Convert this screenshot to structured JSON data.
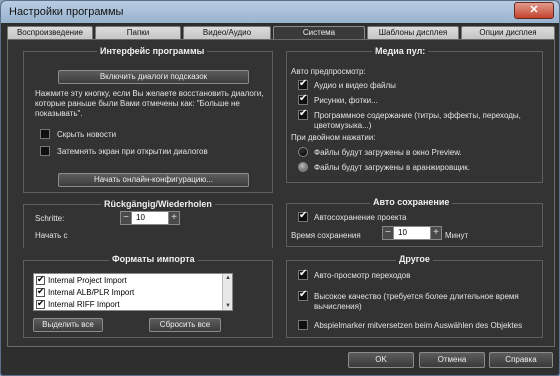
{
  "window": {
    "title": "Настройки программы",
    "close": "✕"
  },
  "tabs": [
    "Воспроизведение",
    "Папки",
    "Видео/Аудио",
    "Система",
    "Шаблоны дисплея",
    "Опции дисплея"
  ],
  "interface": {
    "title": "Интерфейс программы",
    "restore_button": "Включить диалоги подсказок",
    "description": "Нажмите эту кнопку, если Вы желаете восстановить диалоги, которые раньше были Вами отмечены как: \"Больше не показывать\".",
    "hide_news": "Скрыть новости",
    "dim_screen": "Затемнять экран при открытии диалогов",
    "online_config_button": "Начать онлайн-конфигурацию..."
  },
  "undo": {
    "title": "Rückgängig/Wiederholen",
    "steps_label": "Schritte:",
    "steps_value": "10",
    "start_label": "Начать с"
  },
  "import_formats": {
    "title": "Форматы импорта",
    "items": [
      "Internal Project Import",
      "Internal ALB/PLR Import",
      "Internal RIFF Import"
    ],
    "select_all": "Выделить все",
    "reset_all": "Сбросить все"
  },
  "media_pool": {
    "title": "Медиа пул:",
    "auto_preview_label": "Авто предпросмотр:",
    "audio_video": "Аудио и видео файлы",
    "images": "Рисунки, фотки...",
    "program_content": "Программное содержание (титры, эффекты, переходы, цветомузыка...)",
    "double_click_label": "При двойном нажатии:",
    "load_preview": "Файлы будут загружены в окно Preview.",
    "load_arranger": "Файлы будут загружены в аранжировщик."
  },
  "autosave": {
    "title": "Авто сохранение",
    "autosave_project": "Автосохранение проекта",
    "save_time_label": "Время сохранения",
    "save_time_value": "10",
    "minutes": "Минут"
  },
  "other": {
    "title": "Другое",
    "auto_preview_transitions": "Авто-просмотр переходов",
    "high_quality": "Высокое качество (требуется более длительное время вычисления)",
    "playmarker": "Abspielmarker mitversetzen beim Auswählen des Objektes"
  },
  "footer": {
    "ok": "OK",
    "cancel": "Отмена",
    "help": "Справка"
  }
}
